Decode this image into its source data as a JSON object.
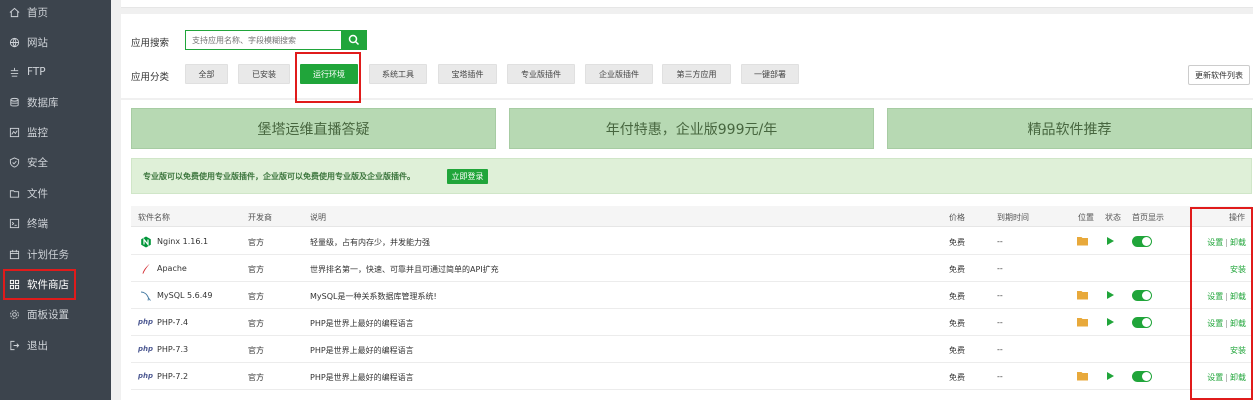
{
  "sidebar": {
    "items": [
      {
        "label": "首页",
        "icon": "home-icon"
      },
      {
        "label": "网站",
        "icon": "globe-icon"
      },
      {
        "label": "FTP",
        "icon": "ftp-icon"
      },
      {
        "label": "数据库",
        "icon": "database-icon"
      },
      {
        "label": "监控",
        "icon": "monitor-icon"
      },
      {
        "label": "安全",
        "icon": "shield-icon"
      },
      {
        "label": "文件",
        "icon": "folder-icon"
      },
      {
        "label": "终端",
        "icon": "terminal-icon"
      },
      {
        "label": "计划任务",
        "icon": "calendar-icon"
      },
      {
        "label": "软件商店",
        "icon": "grid-icon"
      },
      {
        "label": "面板设置",
        "icon": "gear-icon"
      },
      {
        "label": "退出",
        "icon": "logout-icon"
      }
    ],
    "active": "软件商店"
  },
  "search": {
    "label": "应用搜索",
    "placeholder": "支持应用名称、字段模糊搜索"
  },
  "categories": {
    "label": "应用分类",
    "items": [
      "全部",
      "已安装",
      "运行环境",
      "系统工具",
      "宝塔插件",
      "专业版插件",
      "企业版插件",
      "第三方应用",
      "一键部署"
    ],
    "active": "运行环境"
  },
  "update_button": "更新软件列表",
  "banners": [
    "堡塔运维直播答疑",
    "年付特惠，企业版999元/年",
    "精品软件推荐"
  ],
  "notice": {
    "text": "专业版可以免费使用专业版插件，企业版可以免费使用专业版及企业版插件。",
    "button": "立即登录"
  },
  "table": {
    "headers": {
      "name": "软件名称",
      "developer": "开发商",
      "description": "说明",
      "price": "价格",
      "expiry": "到期时间",
      "location": "位置",
      "status": "状态",
      "homepage": "首页显示",
      "actions": "操作"
    },
    "rows": [
      {
        "name": "Nginx 1.16.1",
        "icon": "nginx-icon",
        "developer": "官方",
        "description": "轻量级，占有内存少，并发能力强",
        "price": "免费",
        "expiry": "--",
        "installed": true,
        "actions": [
          "设置",
          "卸载"
        ]
      },
      {
        "name": "Apache",
        "icon": "apache-feather-icon",
        "developer": "官方",
        "description": "世界排名第一，快速、可靠并且可通过简单的API扩充",
        "price": "免费",
        "expiry": "--",
        "installed": false,
        "actions": [
          "安装"
        ]
      },
      {
        "name": "MySQL 5.6.49",
        "icon": "mysql-dolphin-icon",
        "developer": "官方",
        "description": "MySQL是一种关系数据库管理系统!",
        "price": "免费",
        "expiry": "--",
        "installed": true,
        "actions": [
          "设置",
          "卸载"
        ]
      },
      {
        "name": "PHP-7.4",
        "icon": "php-icon",
        "icon_text": "php",
        "developer": "官方",
        "description": "PHP是世界上最好的编程语言",
        "price": "免费",
        "expiry": "--",
        "installed": true,
        "actions": [
          "设置",
          "卸载"
        ]
      },
      {
        "name": "PHP-7.3",
        "icon": "php-icon",
        "icon_text": "php",
        "developer": "官方",
        "description": "PHP是世界上最好的编程语言",
        "price": "免费",
        "expiry": "--",
        "installed": false,
        "actions": [
          "安装"
        ]
      },
      {
        "name": "PHP-7.2",
        "icon": "php-icon",
        "icon_text": "php",
        "developer": "官方",
        "description": "PHP是世界上最好的编程语言",
        "price": "免费",
        "expiry": "--",
        "installed": true,
        "actions": [
          "设置",
          "卸载"
        ]
      }
    ]
  },
  "colors": {
    "primary": "#20a53a",
    "sidebar_bg": "#3c444d",
    "highlight_box": "#e01b1b",
    "banner_bg": "#b7d9b3"
  }
}
